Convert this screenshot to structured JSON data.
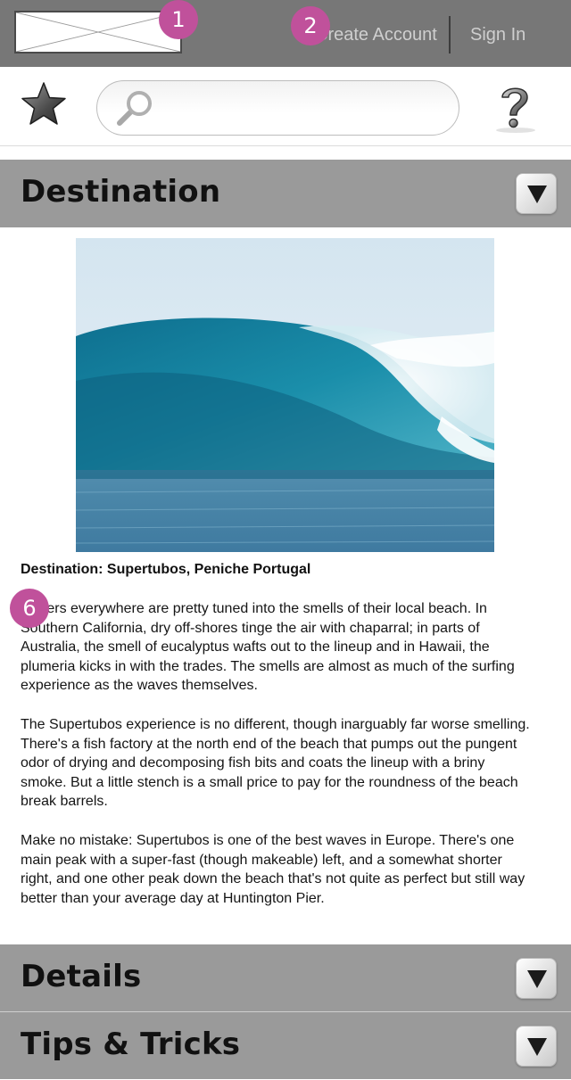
{
  "header": {
    "create_account_label": "Create Account",
    "sign_in_label": "Sign In"
  },
  "badges": {
    "logo_badge": "1",
    "account_badge": "2",
    "text_badge": "6"
  },
  "search": {
    "placeholder": "",
    "value": ""
  },
  "icons": {
    "favorite": "star-icon",
    "search": "magnifier-icon",
    "help": "question-mark-icon",
    "toggle": "triangle-down-icon",
    "logo": "image-placeholder-icon"
  },
  "sections": {
    "destination_title": "Destination",
    "details_title": "Details",
    "tips_title": "Tips & Tricks"
  },
  "article": {
    "caption": "Destination: Supertubos, Peniche Portugal",
    "paragraph_1": "Surfers everywhere are pretty tuned into the smells of their local beach. In Southern California, dry off-shores tinge the air with chaparral; in parts of Australia, the smell of eucalyptus wafts out to the lineup and in Hawaii, the plumeria kicks in with the trades. The smells are almost as much of the surfing experience as the waves themselves.",
    "paragraph_2": "The Supertubos experience is no different, though inarguably far worse smelling. There's a fish factory at the north end of the beach that pumps out the pungent odor of drying and decomposing fish bits and coats the lineup with a briny smoke. But a little stench is a small price to pay for the roundness of the beach break barrels.",
    "paragraph_3": "Make no mistake: Supertubos is one of the best waves in Europe. There's one main peak with a super-fast (though makeable) left, and a somewhat shorter right, and one other peak down the beach that's not quite as perfect but still way better than your average day at Huntington Pier."
  },
  "colors": {
    "topbar": "#777777",
    "section_header": "#9a9a9a",
    "badge": "#c0519b",
    "link": "#cfcfcf"
  }
}
